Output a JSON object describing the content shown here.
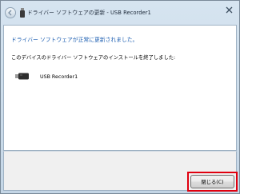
{
  "window": {
    "title": "ドライバー ソフトウェアの更新 - USB Recorder1"
  },
  "content": {
    "heading": "ドライバー ソフトウェアが正常に更新されました。",
    "message": "このデバイスのドライバー ソフトウェアのインストールを終了しました:",
    "device_name": "USB Recorder1"
  },
  "footer": {
    "close_label": "閉じる(C)"
  },
  "icons": {
    "back": "back-arrow-icon",
    "usb": "usb-icon",
    "close": "close-icon"
  },
  "colors": {
    "heading": "#1a5cb0",
    "highlight": "#e0000f"
  }
}
